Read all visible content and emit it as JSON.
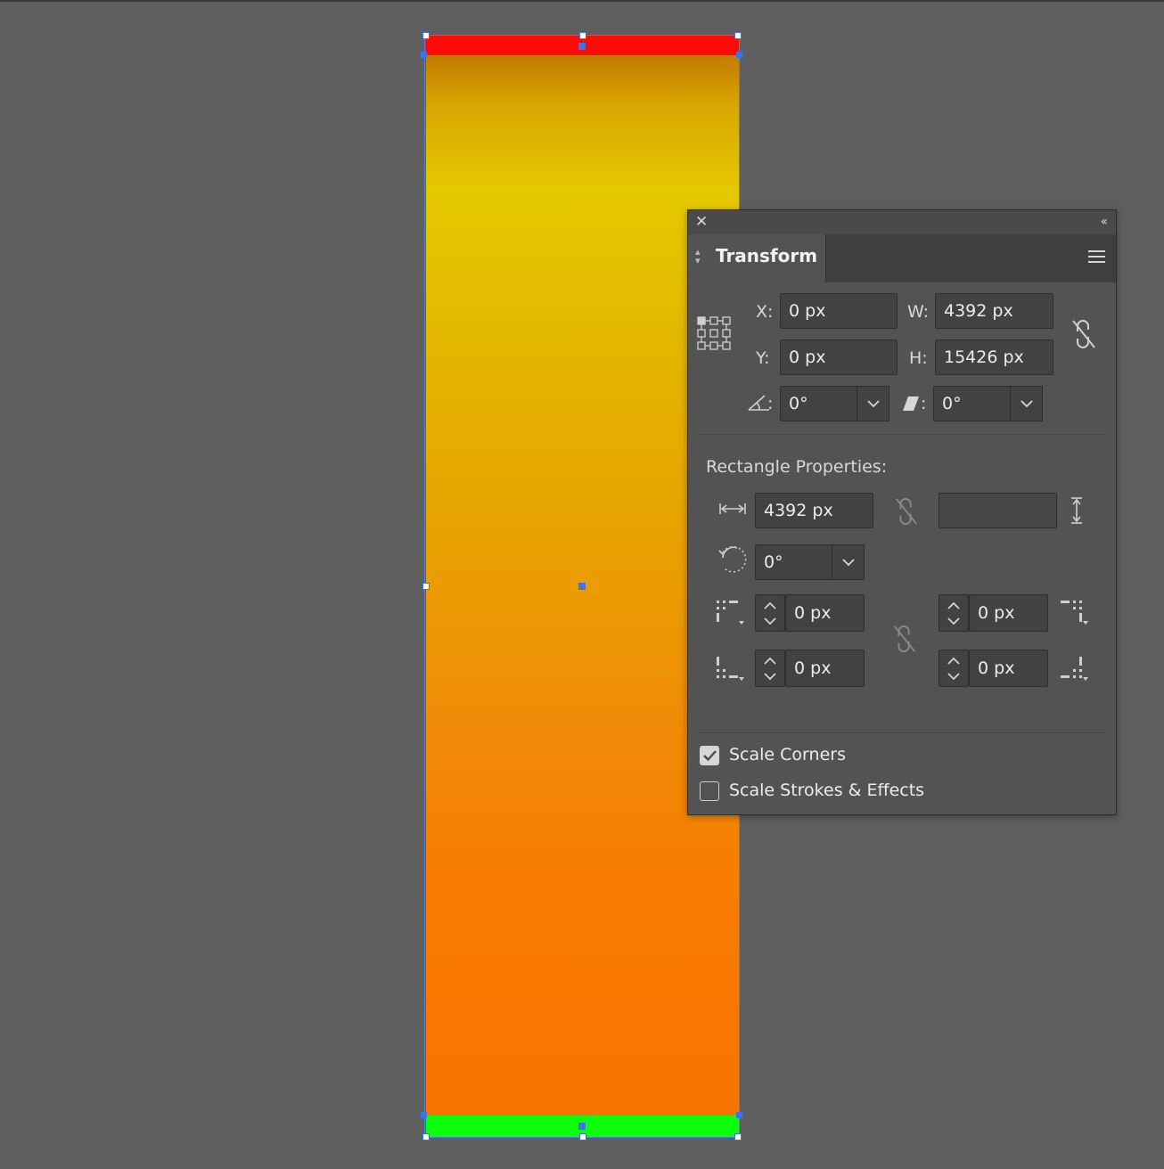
{
  "panel": {
    "tab_label": "Transform",
    "x_label": "X:",
    "x_value": "0 px",
    "y_label": "Y:",
    "y_value": "0 px",
    "w_label": "W:",
    "w_value": "4392 px",
    "h_label": "H:",
    "h_value": "15426 px",
    "angle_label": ":",
    "angle_value": "0°",
    "shear_label": ":",
    "shear_value": "0°",
    "section_title": "Rectangle Properties:",
    "rect_width": "4392 px",
    "rect_height": "",
    "rect_rotation": "0°",
    "corner_tl": "0 px",
    "corner_tr": "0 px",
    "corner_bl": "0 px",
    "corner_br": "0 px",
    "scale_corners_label": "Scale Corners",
    "scale_corners_checked": true,
    "scale_strokes_label": "Scale Strokes & Effects",
    "scale_strokes_checked": false
  },
  "artwork": {
    "colors": {
      "top_bar": "#ff0909",
      "bottom_bar": "#0dff0d",
      "gradient_top": "#c27a00",
      "gradient_mid": "#e5c900",
      "gradient_bottom": "#fa7300",
      "selection": "#3d73e6",
      "canvas": "#5f5f5f"
    }
  },
  "icons": [
    "close-icon",
    "collapse-icon",
    "panel-menu-icon",
    "reference-point-icon",
    "constrain-proportions-icon",
    "rotate-icon",
    "shear-icon",
    "chevron-down-icon",
    "width-icon",
    "height-icon",
    "rotation-icon",
    "corner-type-icon",
    "link-corners-icon",
    "checkmark-icon"
  ]
}
